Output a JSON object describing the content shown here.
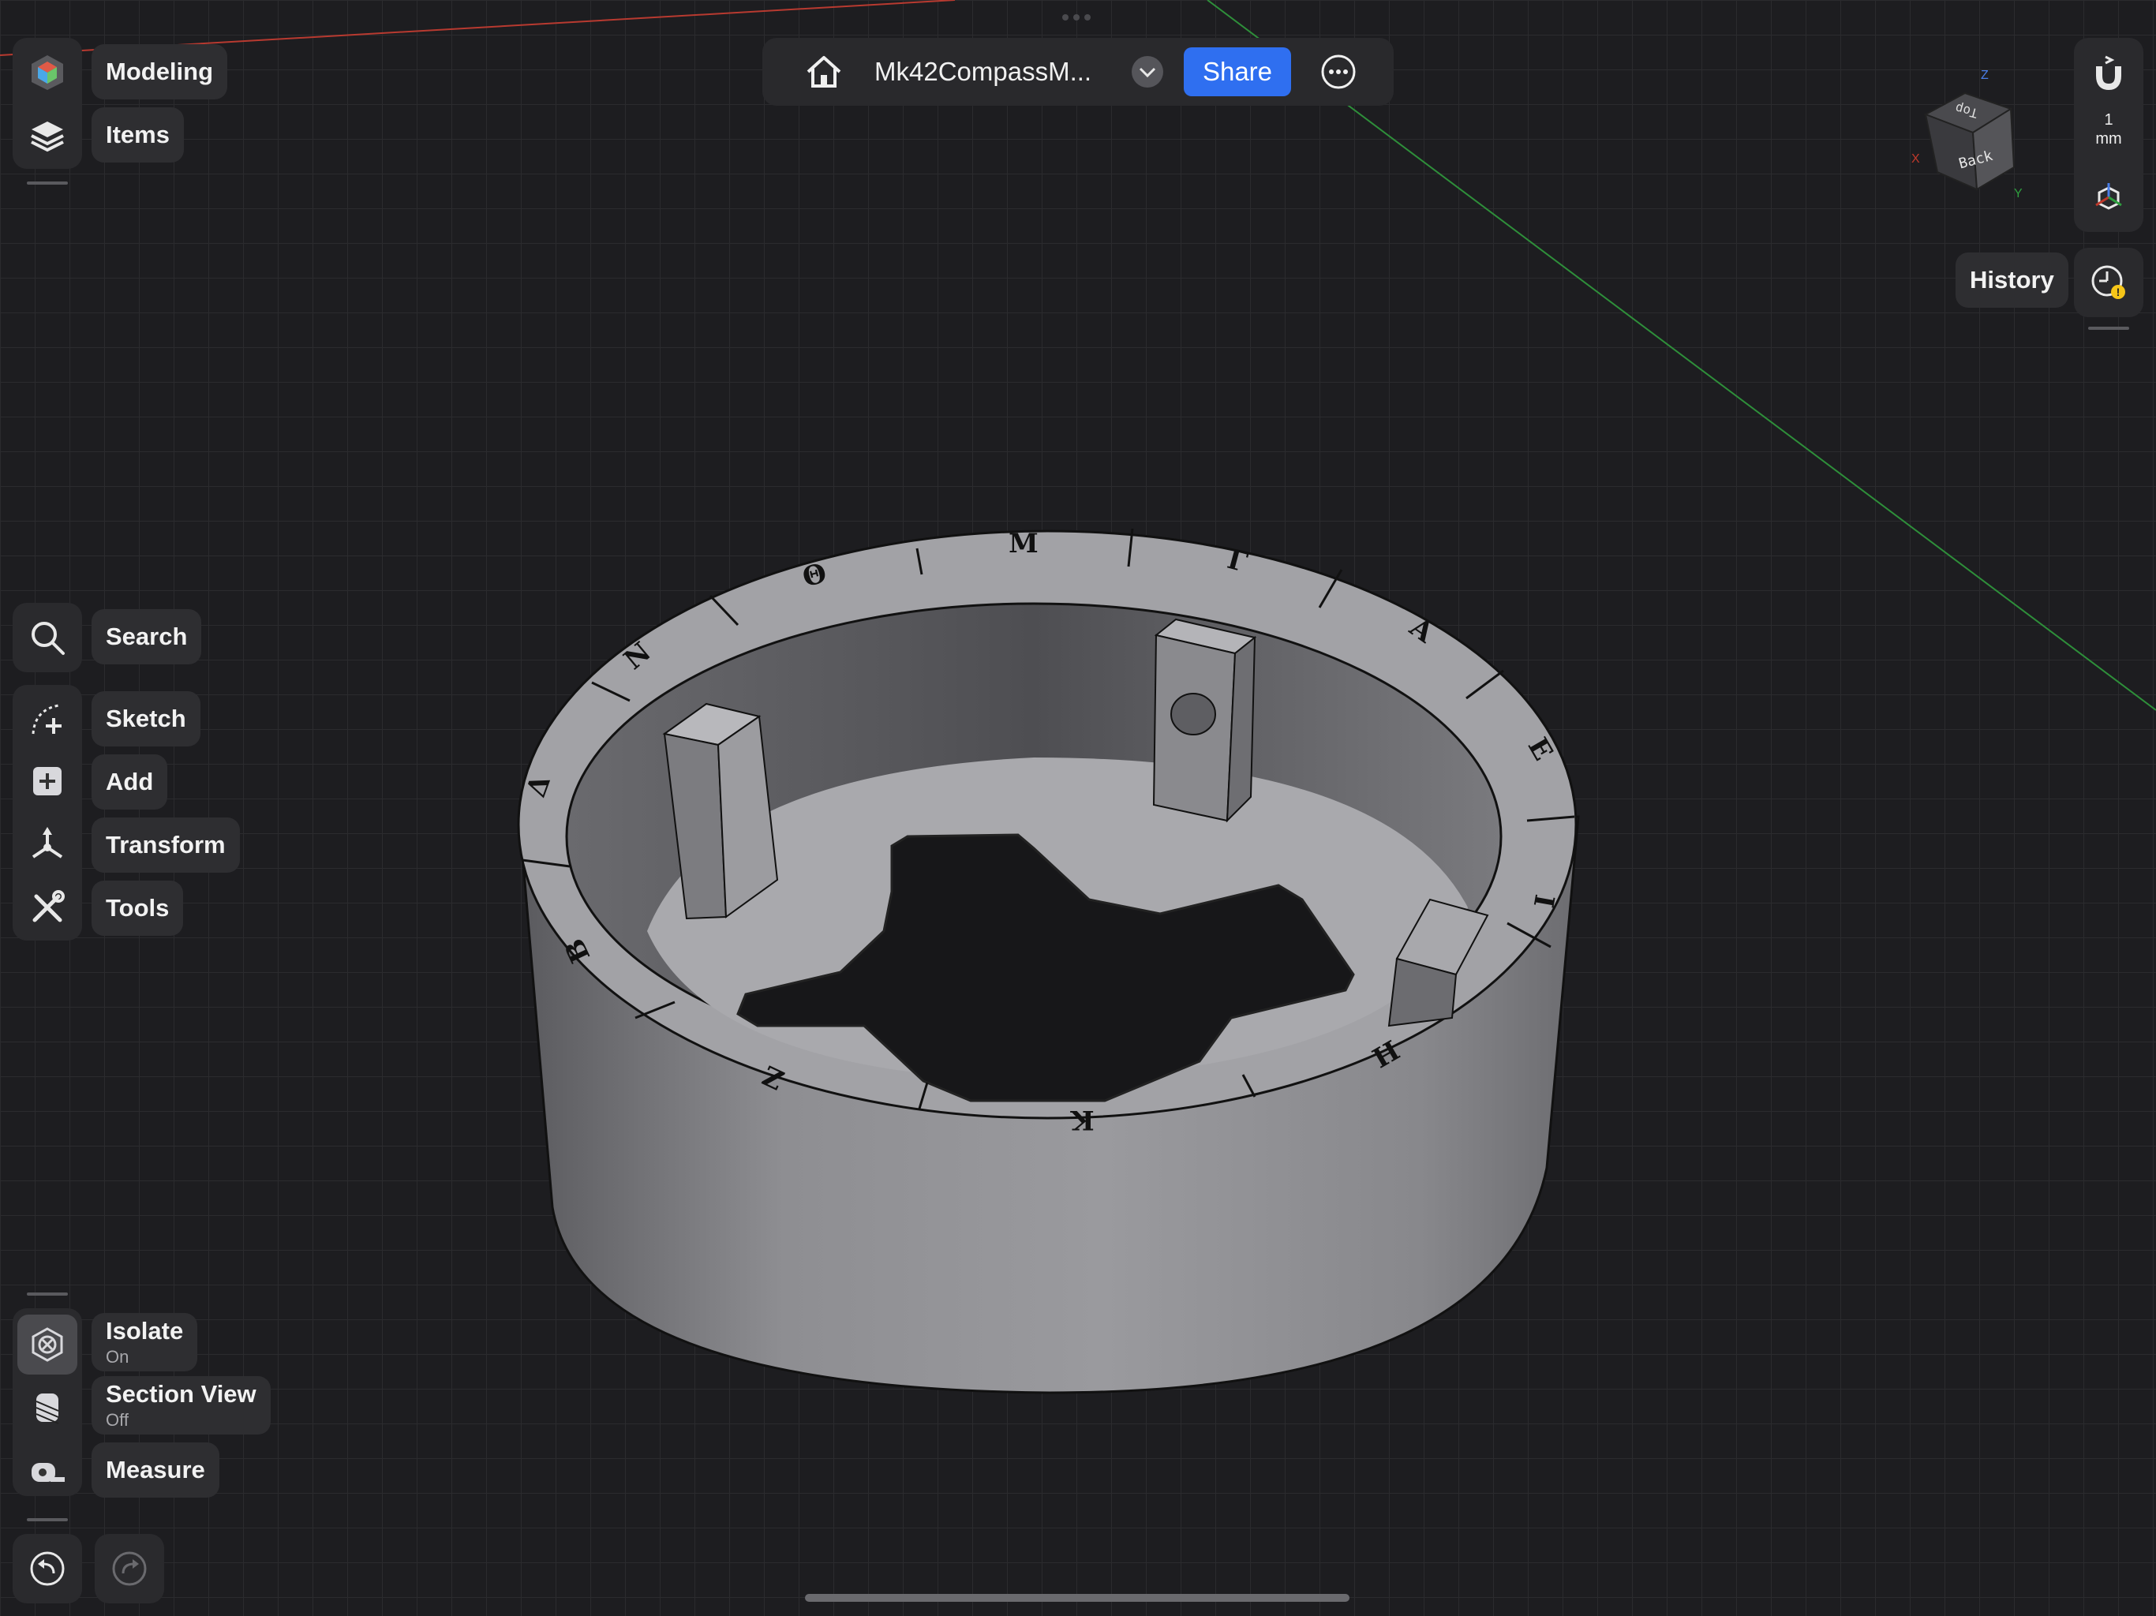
{
  "left_panel": {
    "modeling_label": "Modeling",
    "items_label": "Items",
    "search_label": "Search",
    "sketch_label": "Sketch",
    "add_label": "Add",
    "transform_label": "Transform",
    "tools_label": "Tools",
    "isolate_label": "Isolate",
    "isolate_state": "On",
    "section_view_label": "Section View",
    "section_view_state": "Off",
    "measure_label": "Measure"
  },
  "top_bar": {
    "document_title": "Mk42CompassM...",
    "share_label": "Share"
  },
  "right_panel": {
    "grid_value": "1",
    "grid_unit": "mm",
    "history_label": "History"
  },
  "view_cube": {
    "top_face": "Top",
    "front_face": "Back",
    "axis_x": "X",
    "axis_y": "Y",
    "axis_z": "Z"
  },
  "model": {
    "rim_letters": [
      "Θ",
      "Μ",
      "Γ",
      "Α",
      "Ε",
      "Ι",
      "Η",
      "Κ",
      "Ζ",
      "Β",
      "Δ",
      "Ν"
    ]
  },
  "colors": {
    "accent": "#2f6ff0",
    "background": "#1c1c1e",
    "panel": "#2e2e31",
    "x_axis": "#c0392b",
    "y_axis": "#2e9e3e",
    "warning_badge": "#f5c518"
  }
}
